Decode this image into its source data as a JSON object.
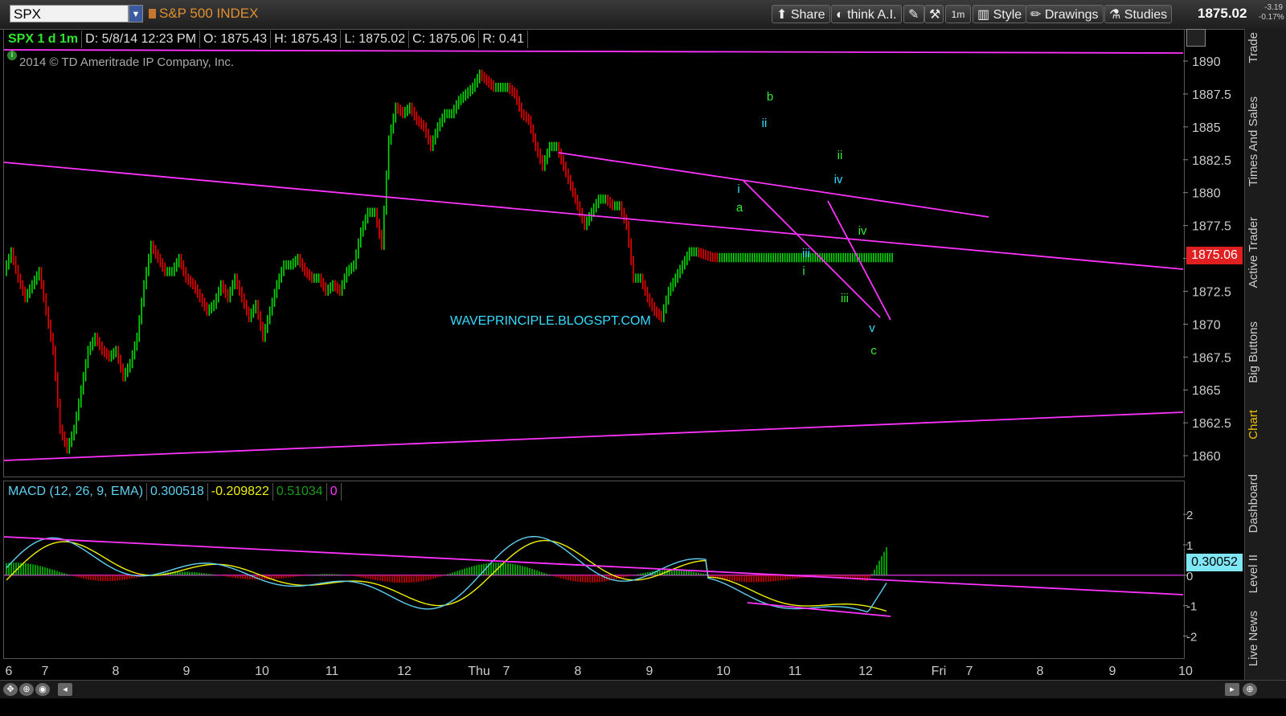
{
  "toolbar": {
    "symbol": "SPX",
    "symbol_name": "S&P 500 INDEX",
    "share_label": "Share",
    "thinkai_label": "think A.I.",
    "interval_badge": "1m",
    "style_label": "Style",
    "drawings_label": "Drawings",
    "studies_label": "Studies",
    "last_price": "1875.02",
    "change_abs": "-3.19",
    "change_pct": "-0.17%"
  },
  "info": {
    "title": "SPX 1 d 1m",
    "date": "D: 5/8/14 12:23 PM",
    "open": "O: 1875.43",
    "high": "H: 1875.43",
    "low": "L: 1875.02",
    "close": "C: 1875.06",
    "range": "R: 0.41",
    "copyright": "2014 © TD Ameritrade IP Company, Inc."
  },
  "macd_info": {
    "name": "MACD (12, 26, 9, EMA)",
    "value": "0.300518",
    "avg": "-0.209822",
    "diff": "0.51034",
    "zero": "0"
  },
  "side_tabs": [
    "Trade",
    "Times And Sales",
    "Active Trader",
    "Big Buttons",
    "Chart",
    "Dashboard",
    "Level II",
    "Live News"
  ],
  "colors": {
    "up": "#00dd00",
    "down": "#ee0000",
    "trendline": "#ff33ff",
    "wave_green": "#33ee33",
    "wave_cyan": "#33ddff",
    "macd_line": "#5fd0f0",
    "macd_avg": "#f0f000",
    "last_price_box": "#e02020"
  },
  "chart_data": [
    {
      "type": "line",
      "description_free": true,
      "x_labels": [
        "6",
        "7",
        "8",
        "9",
        "10",
        "11",
        "12",
        "Thu",
        "7",
        "8",
        "9",
        "10",
        "11",
        "12",
        "Fri",
        "7",
        "8",
        "9",
        "10"
      ],
      "y_ticks": [
        "1890",
        "1887.5",
        "1885",
        "1882.5",
        "1880",
        "1877.5",
        "1875",
        "1872.5",
        "1870",
        "1867.5",
        "1865",
        "1862.5",
        "1860"
      ],
      "ylim": [
        1858.6,
        1891.1
      ],
      "last_value_label": "1875.06",
      "watermark": "WAVEPRINCIPLE.BLOGSPT.COM",
      "series": [
        {
          "x": [
            0,
            0.03,
            0.07,
            0.12,
            0.17,
            0.2,
            0.25,
            0.3,
            0.36,
            0.4,
            0.45,
            0.5,
            0.55,
            0.6,
            0.65,
            0.7,
            0.75,
            0.8,
            0.85,
            0.9,
            0.95,
            1.0,
            1.05,
            1.1,
            1.15,
            1.2,
            1.25,
            1.3,
            1.35,
            1.4,
            1.45,
            1.5,
            1.55,
            1.6,
            1.65,
            1.7,
            1.75,
            1.8,
            1.85,
            1.9,
            1.95,
            2.0,
            2.05,
            2.1,
            2.15,
            2.2,
            2.25,
            2.3,
            2.35,
            2.4,
            2.45,
            2.5,
            2.55,
            2.6,
            2.65,
            2.7,
            2.75,
            2.8,
            2.85,
            2.9,
            2.95,
            3.0,
            3.05,
            3.1,
            3.15,
            3.2,
            3.25,
            3.3,
            3.35,
            3.4,
            3.45,
            3.5,
            3.55,
            3.6,
            3.65,
            3.7,
            3.75,
            3.8,
            3.85,
            3.9,
            3.95,
            4.0,
            4.05,
            4.1,
            4.15,
            4.2,
            4.25,
            4.3,
            4.35,
            4.4,
            4.45,
            4.5,
            4.55,
            4.6,
            4.65,
            4.7,
            4.75,
            4.8,
            4.85,
            4.9,
            4.95,
            5.0,
            5.05,
            5.1,
            5.15,
            5.2,
            5.25,
            5.3,
            5.35,
            5.4,
            5.45,
            5.5,
            5.55,
            5.6,
            5.65,
            5.7,
            5.75,
            5.8,
            5.85,
            5.9,
            5.95,
            6.0,
            6.05,
            6.1,
            6.15,
            6.2,
            6.25,
            6.3
          ],
          "values": [
            1874,
            1875.5,
            1873.5,
            1872,
            1873,
            1874,
            1871,
            1868,
            1862,
            1860.5,
            1862,
            1865,
            1868,
            1869,
            1868,
            1867.5,
            1868,
            1866,
            1867,
            1869,
            1873,
            1876,
            1875,
            1874,
            1874,
            1875,
            1873.5,
            1873,
            1872,
            1871,
            1871.5,
            1873,
            1872,
            1873.5,
            1872,
            1870.5,
            1871.5,
            1869,
            1871,
            1873,
            1874.5,
            1874.5,
            1875,
            1874,
            1873.5,
            1873.5,
            1872.5,
            1873,
            1872.5,
            1874,
            1874.5,
            1877,
            1878.5,
            1878.5,
            1876,
            1884,
            1886.5,
            1886,
            1886.5,
            1885.5,
            1885,
            1883.5,
            1885,
            1886,
            1886,
            1887,
            1887.5,
            1888,
            1889,
            1888.5,
            1888,
            1888,
            1888,
            1887.5,
            1886,
            1885.5,
            1883.5,
            1882,
            1883.5,
            1883.5,
            1882,
            1880.5,
            1879,
            1877.5,
            1878.5,
            1879.5,
            1879.5,
            1879,
            1879,
            1877.5,
            1873.5,
            1873.5,
            1872,
            1871,
            1870.5,
            1872.5,
            1873.5,
            1874.5,
            1875.5,
            1875.5,
            1875.3,
            1875.1,
            1875.06,
            1875.06,
            1875.06,
            1875.06,
            1875.06,
            1875.06,
            1875.06,
            1875.06,
            1875.06,
            1875.06,
            1875.06,
            1875.06,
            1875.06,
            1875.06,
            1875.06,
            1875.06,
            1875.06,
            1875.06,
            1875.06,
            1875.06,
            1875.06,
            1875.06,
            1875.06,
            1875.06,
            1875.06,
            1875.06
          ]
        }
      ],
      "wave_labels": [
        {
          "text": "b",
          "color": "green"
        },
        {
          "text": "ii",
          "color": "cyan"
        },
        {
          "text": "ii",
          "color": "green"
        },
        {
          "text": "iv",
          "color": "cyan"
        },
        {
          "text": "i",
          "color": "cyan"
        },
        {
          "text": "a",
          "color": "green"
        },
        {
          "text": "iv",
          "color": "green"
        },
        {
          "text": "iii",
          "color": "cyan"
        },
        {
          "text": "i",
          "color": "green"
        },
        {
          "text": "iii",
          "color": "green"
        },
        {
          "text": "v",
          "color": "cyan"
        },
        {
          "text": "c",
          "color": "green"
        }
      ]
    },
    {
      "type": "bar",
      "y_ticks": [
        "2",
        "1",
        "0",
        "-1",
        "-2"
      ],
      "ylim": [
        -2.7,
        2.4
      ],
      "last_value_label": "0.30052",
      "series": [
        {
          "name": "MACD",
          "values": [
            0.3
          ]
        },
        {
          "name": "Avg",
          "values": [
            -0.21
          ]
        },
        {
          "name": "Diff",
          "values": [
            0.51
          ]
        }
      ]
    }
  ]
}
